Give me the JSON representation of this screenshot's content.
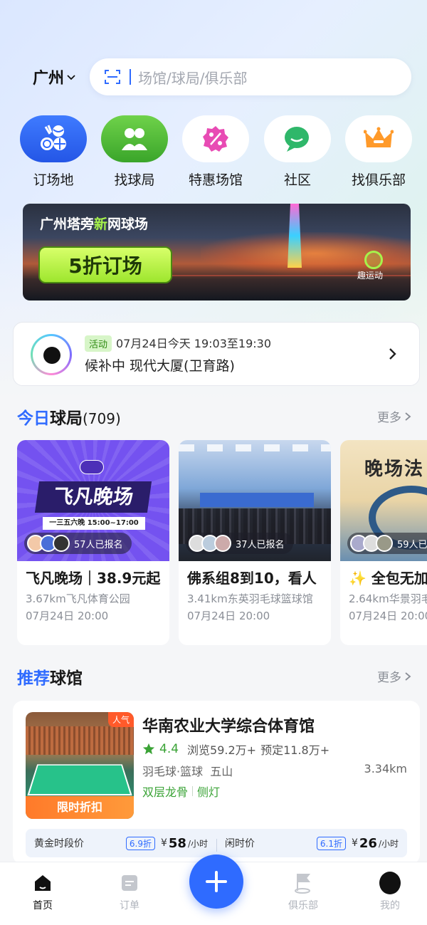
{
  "header": {
    "city": "广州",
    "search_placeholder": "场馆/球局/俱乐部"
  },
  "quick_entries": [
    {
      "label": "订场地",
      "icon": "balls-icon",
      "color": "#2f6bff"
    },
    {
      "label": "找球局",
      "icon": "group-icon",
      "color": "#4fbe3a"
    },
    {
      "label": "特惠场馆",
      "icon": "discount-icon",
      "color": "#e84bb4"
    },
    {
      "label": "社区",
      "icon": "chat-bubble-icon",
      "color": "#2fb76a"
    },
    {
      "label": "找俱乐部",
      "icon": "crown-icon",
      "color": "#ff9a2a"
    }
  ],
  "banner": {
    "title_part1": "广州塔旁",
    "title_accent": "新",
    "title_part2": "网球场",
    "cta": "5折订场",
    "brand": "趣运动"
  },
  "activity": {
    "tag": "活动",
    "time": "07月24日今天 19:03至19:30",
    "desc": "候补中 现代大厦(卫育路)"
  },
  "today_games": {
    "title_accent": "今日",
    "title_rest": "球局",
    "count": "(709)",
    "more": "更多",
    "items": [
      {
        "img_title": "飞凡晚场",
        "img_strip": "一三五六晚  15:00~17:00",
        "signup": "57人已报名",
        "title": "飞凡晚场｜38.9元起",
        "location": "3.67km飞凡体育公园",
        "date": "07月24日 20:00"
      },
      {
        "signup": "37人已报名",
        "title": "佛系组8到10，看人",
        "location": "3.41km东英羽毛球篮球馆",
        "date": "07月24日 20:00"
      },
      {
        "img_title": "晚场法",
        "signup": "59人已报名",
        "title": "✨ 全包无加",
        "location": "2.64km华景羽毛",
        "date": "07月24日 20:00"
      }
    ]
  },
  "recommended": {
    "title_accent": "推荐",
    "title_rest": "球馆",
    "more": "更多",
    "venue": {
      "hot": "人气",
      "discount_label": "限时折扣",
      "name": "华南农业大学综合体育馆",
      "rating": "4.4",
      "views": "浏览59.2万+",
      "bookings": "预定11.8万+",
      "sports": "羽毛球·篮球",
      "district": "五山",
      "distance": "3.34km",
      "tag1": "双层龙骨",
      "tag2": "侧灯",
      "prices": [
        {
          "label": "黄金时段价",
          "discount": "6.9折",
          "currency": "¥",
          "value": "58",
          "unit": "/小时"
        },
        {
          "label": "闲时价",
          "discount": "6.1折",
          "currency": "¥",
          "value": "26",
          "unit": "/小时"
        }
      ]
    }
  },
  "tabbar": {
    "items": [
      {
        "label": "首页",
        "icon": "home-icon"
      },
      {
        "label": "订单",
        "icon": "order-icon"
      },
      {
        "label": "俱乐部",
        "icon": "club-flag-icon"
      },
      {
        "label": "我的",
        "icon": "avatar"
      }
    ],
    "fab_icon": "plus-icon"
  }
}
